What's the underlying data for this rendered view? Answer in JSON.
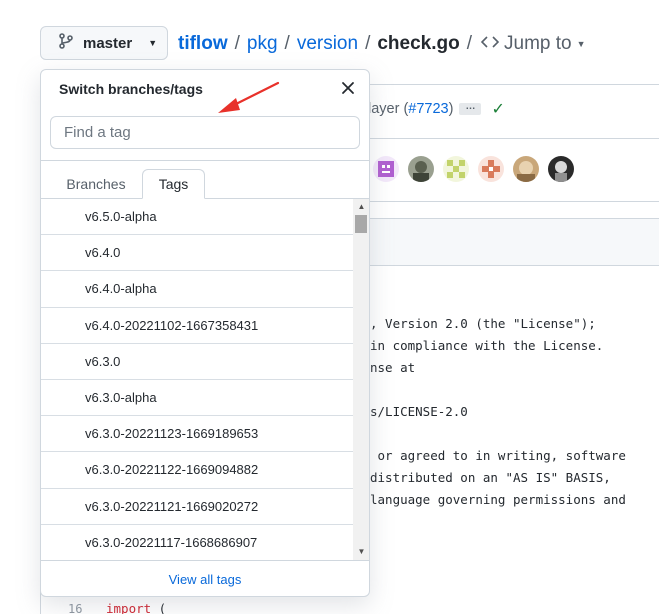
{
  "repo_nav": {
    "branch_label": "master",
    "owner": "tiflow",
    "path": [
      "pkg",
      "version"
    ],
    "file": "check.go",
    "separator": "/",
    "jump_label": "Jump to"
  },
  "commit": {
    "message_fragment": "layer (",
    "pr_link": "#7723",
    "message_close": ")",
    "ellipsis": "…"
  },
  "code_lines": [
    ", Version 2.0 (the \"License\");",
    "in compliance with the License.",
    "nse at",
    "",
    "s/LICENSE-2.0",
    "",
    " or agreed to in writing, software",
    "distributed on an \"AS IS\" BASIS,",
    "language governing permissions and"
  ],
  "last_line": {
    "number": "16",
    "keyword": "import",
    "rest": " ("
  },
  "dropdown": {
    "title": "Switch branches/tags",
    "search_placeholder": "Find a tag",
    "tabs": {
      "branches": "Branches",
      "tags": "Tags"
    },
    "active_tab": "tags",
    "tags": [
      "v6.5.0-alpha",
      "v6.4.0",
      "v6.4.0-alpha",
      "v6.4.0-20221102-1667358431",
      "v6.3.0",
      "v6.3.0-alpha",
      "v6.3.0-20221123-1669189653",
      "v6.3.0-20221122-1669094882",
      "v6.3.0-20221121-1669020272",
      "v6.3.0-20221117-1668686907"
    ],
    "footer_link": "View all tags"
  },
  "colors": {
    "link": "#0969da",
    "border": "#d0d7de",
    "arrow": "#e8312a",
    "success": "#1a7f37"
  }
}
